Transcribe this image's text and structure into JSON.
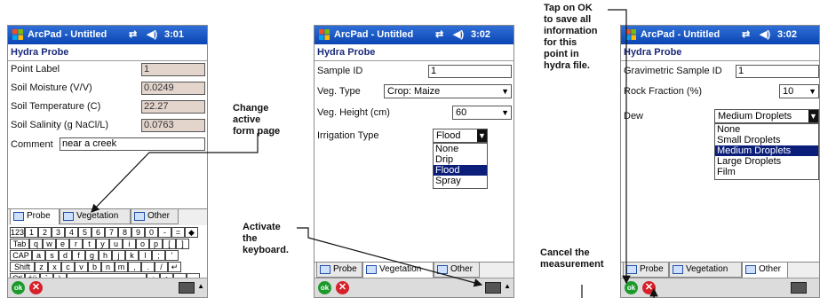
{
  "app": {
    "title": "ArcPad - Untitled"
  },
  "screens": [
    {
      "time": "3:01",
      "form_name": "Hydra Probe",
      "fields": [
        {
          "label": "Point Label",
          "value": "1"
        },
        {
          "label": "Soil Moisture (V/V)",
          "value": "0.0249"
        },
        {
          "label": "Soil Temperature (C)",
          "value": "22.27"
        },
        {
          "label": "Soil Salinity (g NaCl/L)",
          "value": "0.0763"
        },
        {
          "label": "Comment",
          "value": "near a creek"
        }
      ],
      "tabs": [
        "Probe",
        "Vegetation",
        "Other"
      ],
      "keyboard_rows": [
        [
          "123",
          "1",
          "2",
          "3",
          "4",
          "5",
          "6",
          "7",
          "8",
          "9",
          "0",
          "-",
          "=",
          "◆"
        ],
        [
          "Tab",
          "q",
          "w",
          "e",
          "r",
          "t",
          "y",
          "u",
          "i",
          "o",
          "p",
          "[",
          "]"
        ],
        [
          "CAP",
          "a",
          "s",
          "d",
          "f",
          "g",
          "h",
          "j",
          "k",
          "l",
          ";",
          "'"
        ],
        [
          "Shift",
          "z",
          "x",
          "c",
          "v",
          "b",
          "n",
          "m",
          ",",
          ".",
          "/",
          "↵"
        ],
        [
          "Ctl",
          "áü",
          "`",
          "\\",
          "",
          "↓",
          "↑",
          "←",
          "→"
        ]
      ]
    },
    {
      "time": "3:02",
      "form_name": "Hydra Probe",
      "sample_id_label": "Sample ID",
      "sample_id_value": "1",
      "veg_type_label": "Veg. Type",
      "veg_type_value": "Crop: Maize",
      "veg_height_label": "Veg. Height (cm)",
      "veg_height_value": "60",
      "irrigation_label": "Irrigation Type",
      "irrigation_value": "Flood",
      "irrigation_options": [
        "None",
        "Drip",
        "Flood",
        "Spray"
      ],
      "tabs": [
        "Probe",
        "Vegetation",
        "Other"
      ]
    },
    {
      "time": "3:02",
      "form_name": "Hydra Probe",
      "grav_label": "Gravimetric Sample ID",
      "grav_value": "1",
      "rock_label": "Rock Fraction (%)",
      "rock_value": "10",
      "dew_label": "Dew",
      "dew_value": "Medium Droplets",
      "dew_options": [
        "None",
        "Small Droplets",
        "Medium Droplets",
        "Large Droplets",
        "Film"
      ],
      "tabs": [
        "Probe",
        "Vegetation",
        "Other"
      ]
    }
  ],
  "buttons": {
    "ok": "ok",
    "cancel": "✕"
  },
  "annotations": {
    "change_page": [
      "Change",
      "active",
      "form page"
    ],
    "activate_keyboard": [
      "Activate",
      "the",
      "keyboard."
    ],
    "tap_ok": [
      "Tap on OK",
      "to save all",
      "information",
      "for this",
      "point in",
      "hydra file."
    ],
    "cancel": [
      "Cancel the",
      "measurement"
    ]
  },
  "colors": {
    "title_bar": "#0c45b4",
    "readonly_field": "#e3d4cc",
    "selected_item": "#0b1f7a",
    "ok": "#1b9a2b",
    "cancel": "#d6202a"
  }
}
